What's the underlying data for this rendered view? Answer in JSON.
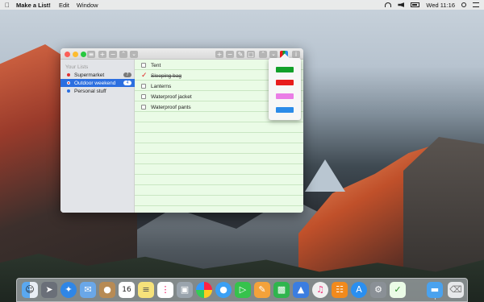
{
  "menubar": {
    "app_name": "Make a List!",
    "items": [
      "Edit",
      "Window"
    ],
    "clock": "Wed 11:16"
  },
  "sidebar": {
    "header": "Your Lists",
    "lists": [
      {
        "label": "Supermarket",
        "color": "#e03030",
        "count": "7",
        "active": false
      },
      {
        "label": "Outdoor weekend",
        "color": "#e03030",
        "count": "4",
        "active": true
      },
      {
        "label": "Personal stuff",
        "color": "#2c6fe0",
        "count": "",
        "active": false
      }
    ]
  },
  "tasks": [
    {
      "label": "Tent",
      "done": false
    },
    {
      "label": "Sleeping bag",
      "done": true
    },
    {
      "label": "Lanterns",
      "done": false
    },
    {
      "label": "Waterproof jacket",
      "done": false
    },
    {
      "label": "Waterproof pants",
      "done": false
    }
  ],
  "color_picker": {
    "swatches": [
      "#12a02a",
      "#e81c1c",
      "#ea7de6",
      "#2b8be8"
    ]
  },
  "dock": {
    "icons": [
      "finder-icon",
      "launchpad-icon",
      "safari-icon",
      "mail-icon",
      "contacts-icon",
      "calendar-icon",
      "notes-icon",
      "reminders-icon",
      "photo-booth-icon",
      "photos-icon",
      "messages-icon",
      "facetime-icon",
      "pages-icon",
      "numbers-icon",
      "keynote-icon",
      "itunes-icon",
      "ibooks-icon",
      "app-store-icon",
      "system-preferences-icon",
      "make-a-list-icon",
      "folder-icon",
      "trash-icon"
    ],
    "calendar_day": "16"
  }
}
